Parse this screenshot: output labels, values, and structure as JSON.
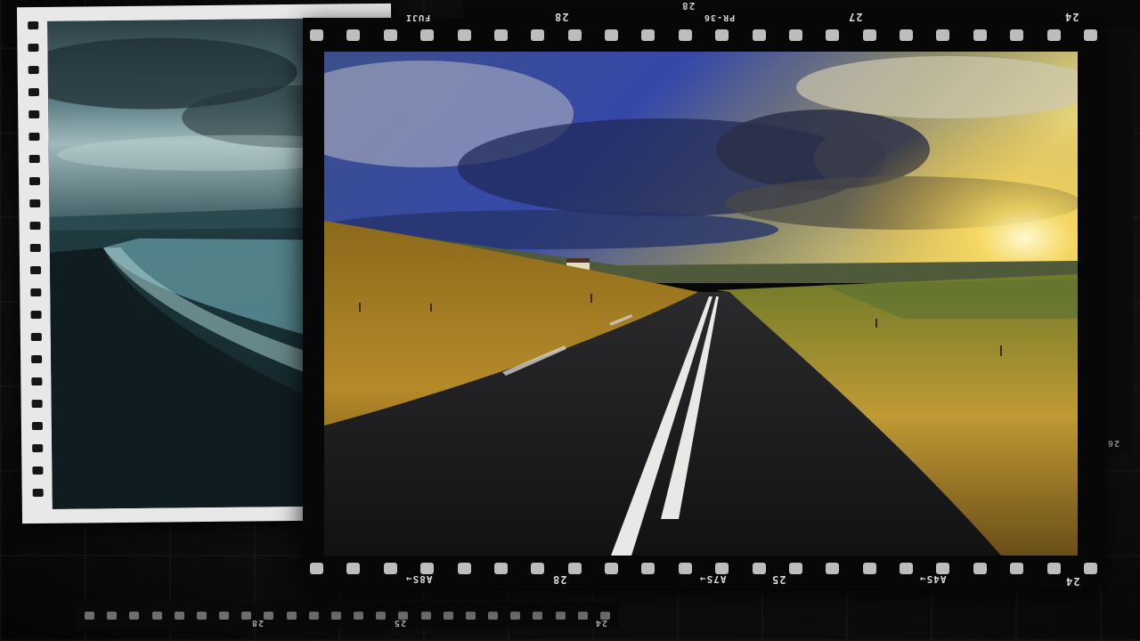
{
  "film_text": {
    "top_brand": "FUJI",
    "top_28": "28",
    "top_pr36": "PR-36",
    "top_27": "27",
    "top_24": "24",
    "back_top_28": "28",
    "bottom_28a": "A8S→",
    "bottom_28": "28",
    "bottom_27a": "A7S→",
    "bottom_25": "25",
    "bottom_24a": "A4S→",
    "bottom_24": "24",
    "back_bottom_28": "28",
    "back_bottom_25": "25",
    "back_bottom_24": "24",
    "right_26": "26"
  }
}
